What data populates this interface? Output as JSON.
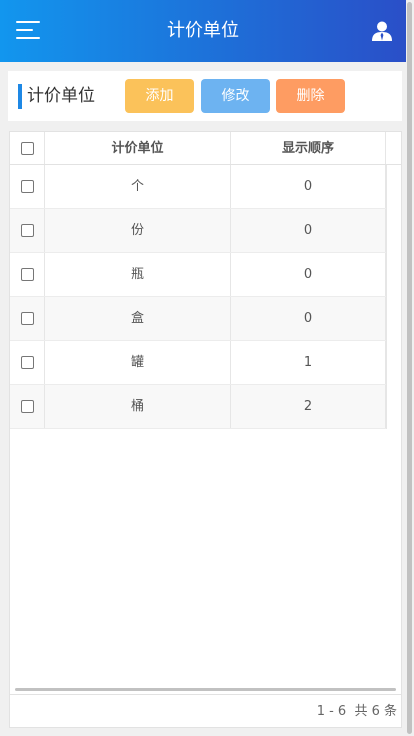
{
  "header": {
    "title": "计价单位",
    "menu_icon": "menu-icon",
    "user_icon": "user-icon"
  },
  "toolbar": {
    "title": "计价单位",
    "add_label": "添加",
    "edit_label": "修改",
    "delete_label": "删除",
    "colors": {
      "add": "#fbc25a",
      "edit": "#6db3f1",
      "delete": "#fe9c62",
      "accent": "#1e88e5"
    }
  },
  "table": {
    "columns": [
      "计价单位",
      "显示顺序"
    ],
    "rows": [
      {
        "name": "个",
        "order": "0"
      },
      {
        "name": "份",
        "order": "0"
      },
      {
        "name": "瓶",
        "order": "0"
      },
      {
        "name": "盒",
        "order": "0"
      },
      {
        "name": "罐",
        "order": "1"
      },
      {
        "name": "桶",
        "order": "2"
      }
    ]
  },
  "pager": {
    "range": "1 - 6",
    "total": "共 6 条"
  }
}
